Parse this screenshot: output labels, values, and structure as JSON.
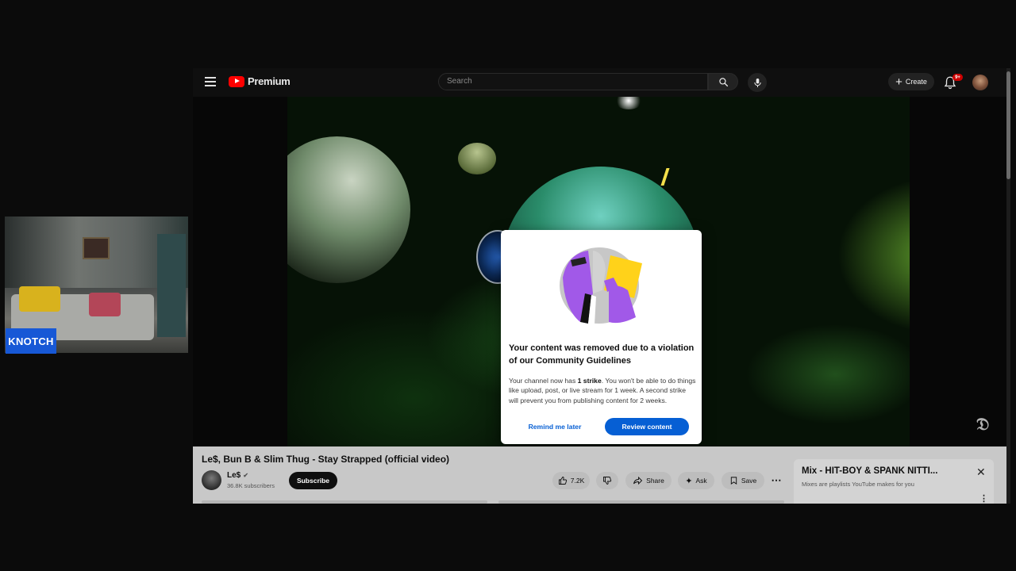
{
  "webcam": {
    "label": "KNOTCH"
  },
  "header": {
    "logo_text": "Premium",
    "search_placeholder": "Search",
    "create_label": "Create",
    "notification_badge": "9+"
  },
  "modal": {
    "title": "Your content was removed due to a violation of our Community Guidelines",
    "body_pre": "Your channel now has ",
    "body_strike": "1 strike",
    "body_post": ". You won't be able to do things like upload, post, or live stream for 1 week. A second strike will prevent you from publishing content for 2 weeks.",
    "remind_label": "Remind me later",
    "review_label": "Review content"
  },
  "video": {
    "title": "Le$, Bun B & Slim Thug - Stay Strapped (official video)",
    "channel_name": "Le$",
    "subscribers": "36.8K subscribers",
    "subscribe_label": "Subscribe",
    "likes": "7.2K",
    "share_label": "Share",
    "ask_label": "Ask",
    "save_label": "Save"
  },
  "mix": {
    "title": "Mix - HIT-BOY & SPANK NITTI...",
    "subtitle": "Mixes are playlists YouTube makes for you"
  },
  "colors": {
    "accent_blue": "#065fd4",
    "brand_red": "#ff0000",
    "webcam_label_bg": "#1758d6"
  }
}
